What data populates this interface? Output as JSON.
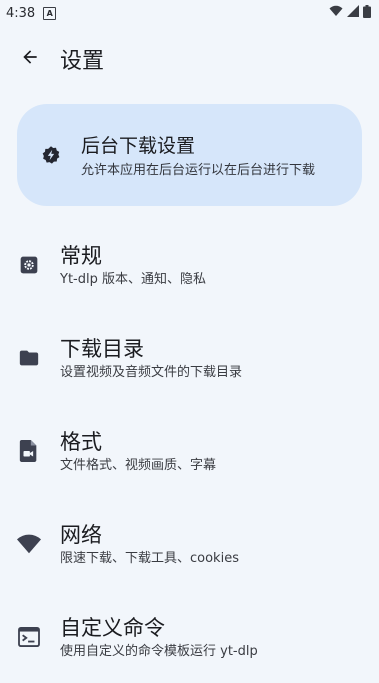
{
  "status_bar": {
    "time": "4:38",
    "notification_badge": "A",
    "icons": [
      "wifi-icon",
      "signal-icon",
      "battery-icon"
    ]
  },
  "header": {
    "back_icon": "arrow-back-icon",
    "title": "设置"
  },
  "banner": {
    "icon": "bolt-badge-icon",
    "title": "后台下载设置",
    "description": "允许本应用在后台运行以在后台进行下载"
  },
  "items": [
    {
      "icon": "gear-icon",
      "title": "常规",
      "subtitle": "Yt-dlp 版本、通知、隐私"
    },
    {
      "icon": "folder-icon",
      "title": "下载目录",
      "subtitle": "设置视频及音频文件的下载目录"
    },
    {
      "icon": "video-file-icon",
      "title": "格式",
      "subtitle": "文件格式、视频画质、字幕"
    },
    {
      "icon": "wifi-icon",
      "title": "网络",
      "subtitle": "限速下载、下载工具、cookies"
    },
    {
      "icon": "terminal-icon",
      "title": "自定义命令",
      "subtitle": "使用自定义的命令模板运行 yt-dlp"
    }
  ],
  "colors": {
    "background": "#f2f6fb",
    "banner_bg": "#d6e6fa",
    "icon": "#3d4150"
  }
}
